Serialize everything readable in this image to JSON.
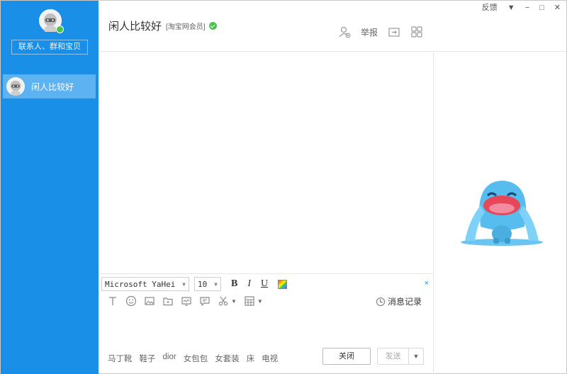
{
  "window": {
    "feedback_label": "反馈",
    "menu_glyph": "▼",
    "minimize_glyph": "−",
    "maximize_glyph": "□",
    "close_glyph": "✕"
  },
  "sidebar": {
    "search_placeholder": "联系人、群和宝贝",
    "contacts": [
      {
        "name": "闲人比较好",
        "selected": true
      }
    ],
    "accent_color": "#1a8fe8"
  },
  "header": {
    "contact_name": "闲人比较好",
    "member_badge": "[淘宝网会员]",
    "report_label": "举报"
  },
  "composer": {
    "font_family": "Microsoft YaHei",
    "font_size": "10",
    "bold": "B",
    "italic": "I",
    "underline": "U",
    "close_x": "×",
    "history_label": "消息记录",
    "tags": [
      "马丁靴",
      "鞋子",
      "dior",
      "女包包",
      "女套装",
      "床",
      "电视"
    ],
    "close_button": "关闭",
    "send_button": "发送",
    "send_dropdown": "▼"
  }
}
